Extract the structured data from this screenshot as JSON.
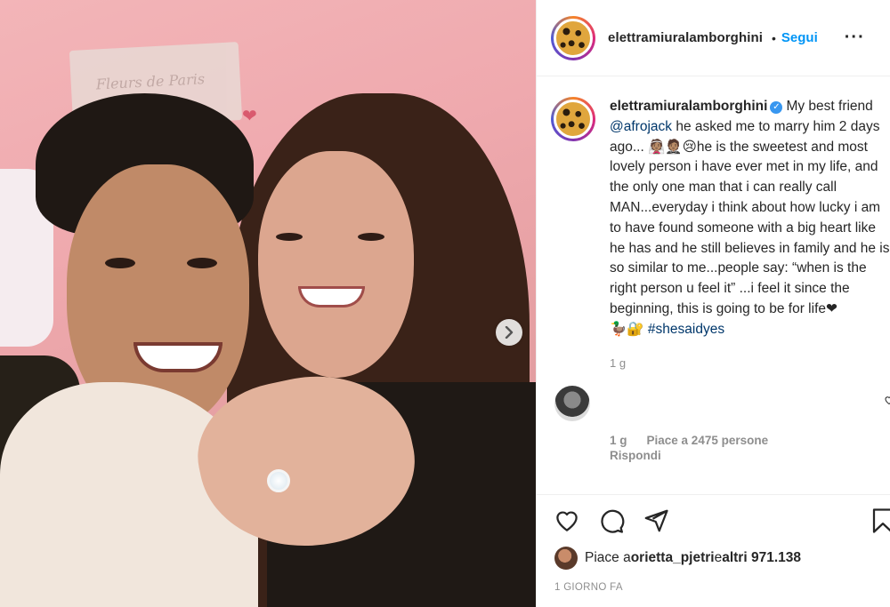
{
  "post": {
    "username": "elettramiuralamborghini",
    "follow_label": "Segui",
    "dot": "•",
    "more_label": "···"
  },
  "caption": {
    "username": "elettramiuralamborghini",
    "text_1": "My best friend ",
    "mention": "@afrojack",
    "text_2": " he asked me to marry him 2 days ago... 👰🏽🤵🏽😢he is the sweetest and most lovely person i have ever met in my life, and the only one man that i can really call MAN...everyday i think about how lucky i am to have found someone with a big heart like he has and he still believes in family and he is so similar to me...people say: “when is the right person u feel it” ...i feel it since the beginning, this is going to be for life❤",
    "emoji_line": "🦆🔐 ",
    "hashtag": "#shesaidyes",
    "time": "1 g"
  },
  "comment": {
    "time": "1 g",
    "likes_label": "Piace a 2475 persone",
    "reply_label": "Rispondi"
  },
  "likes": {
    "prefix": "Piace a ",
    "user": "orietta_pjetri",
    "middle": " e ",
    "others": "altri 971.138"
  },
  "date": "1 GIORNO FA",
  "photo_text": {
    "frame_text": "Fleurs de Paris"
  },
  "icons": [
    "verified-icon",
    "heart-icon",
    "comment-icon",
    "share-icon",
    "save-icon",
    "next-arrow-icon",
    "more-icon"
  ],
  "colors": {
    "accent": "#0095f6",
    "verified": "#3897f0",
    "muted": "#8e8e8e",
    "text": "#262626"
  }
}
